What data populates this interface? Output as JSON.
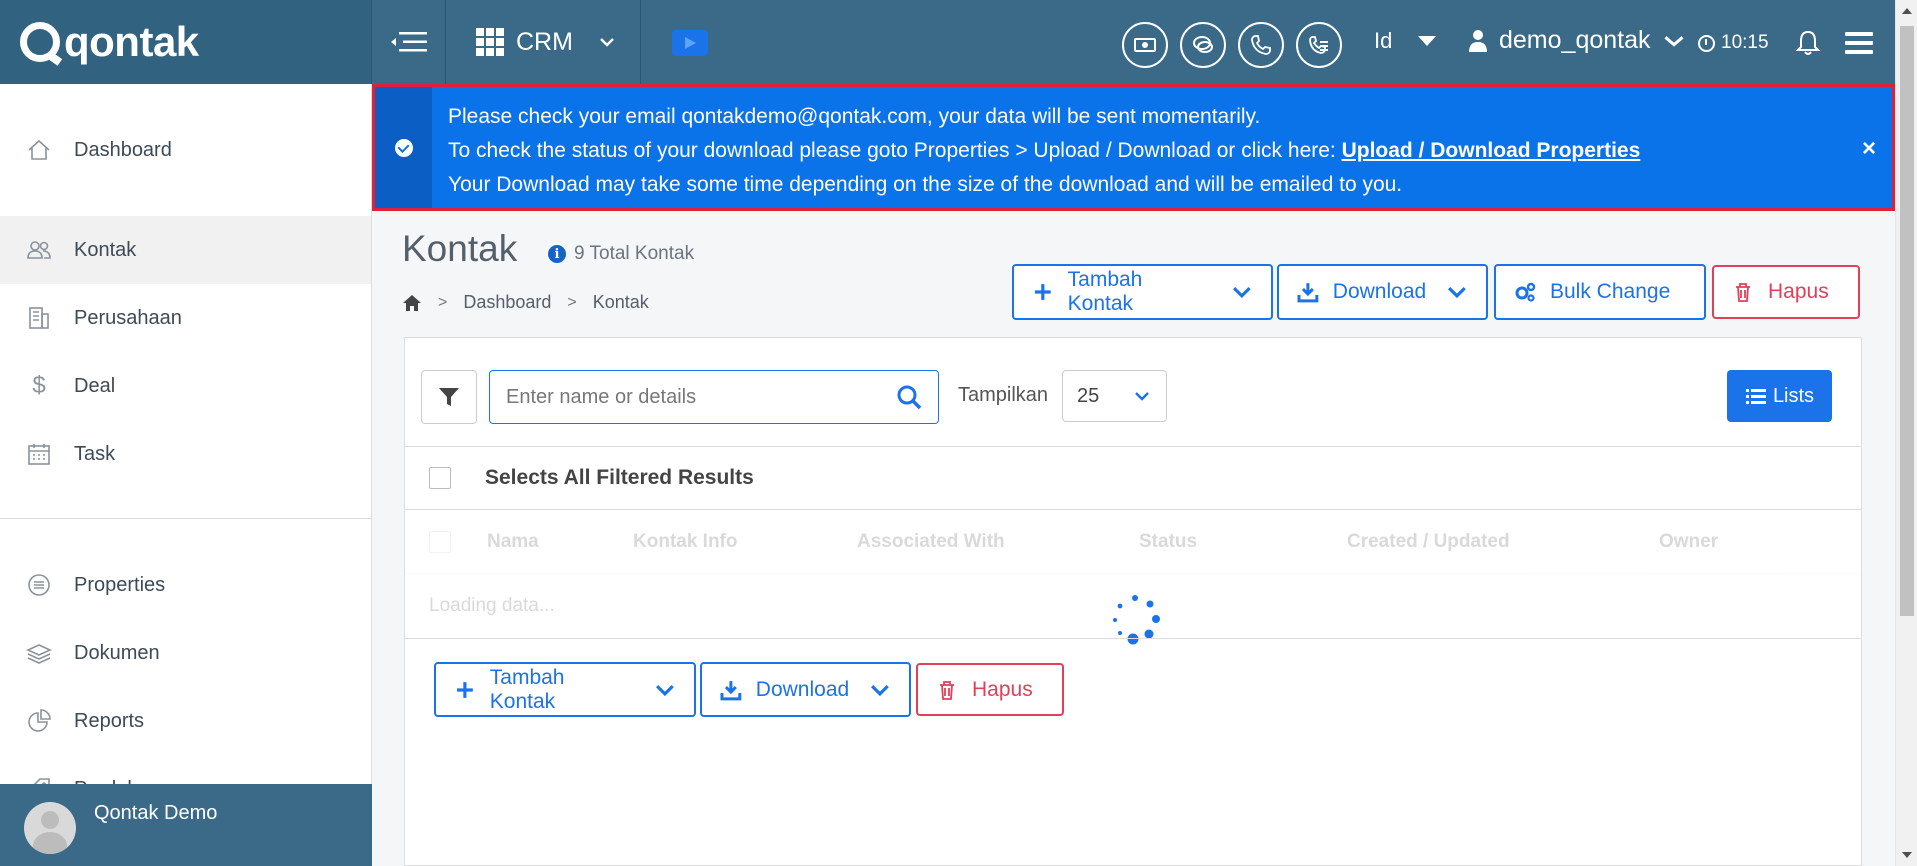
{
  "app": {
    "logo_text": "qontak",
    "module_label": "CRM",
    "lang_label": "Id",
    "username": "demo_qontak",
    "time": "10:15"
  },
  "sidebar": {
    "items": [
      {
        "label": "Dashboard",
        "icon": "home-icon"
      },
      {
        "label": "Kontak",
        "icon": "contacts-icon"
      },
      {
        "label": "Perusahaan",
        "icon": "building-icon"
      },
      {
        "label": "Deal",
        "icon": "dollar-icon"
      },
      {
        "label": "Task",
        "icon": "calendar-icon"
      },
      {
        "label": "Properties",
        "icon": "list-circle-icon"
      },
      {
        "label": "Dokumen",
        "icon": "layers-icon"
      },
      {
        "label": "Reports",
        "icon": "pie-chart-icon"
      },
      {
        "label": "Produk",
        "icon": "tag-icon"
      }
    ],
    "user_name": "Qontak Demo"
  },
  "alert": {
    "line1": "Please check your email qontakdemo@qontak.com, your data will be sent momentarily.",
    "line2_prefix": "To check the status of your download please goto Properties > Upload / Download or click here: ",
    "line2_link": "Upload / Download Properties",
    "line3": "Your Download may take some time depending on the size of the download and will be emailed to you.",
    "close_label": "×",
    "color": "#0a73ea"
  },
  "page": {
    "title": "Kontak",
    "total_label": "9 Total Kontak",
    "breadcrumb": [
      "Dashboard",
      "Kontak"
    ]
  },
  "actions": {
    "add_contact": "Tambah Kontak",
    "download": "Download",
    "bulk_change": "Bulk Change",
    "delete": "Hapus"
  },
  "toolbar": {
    "search_placeholder": "Enter name or details",
    "show_label": "Tampilkan",
    "page_size": "25",
    "lists_label": "Lists"
  },
  "table": {
    "select_all_label": "Selects All Filtered Results",
    "columns": [
      "Nama",
      "Kontak Info",
      "Associated With",
      "Status",
      "Created / Updated",
      "Owner"
    ],
    "loading_text": "Loading data..."
  },
  "colors": {
    "topbar": "#3a6a87",
    "primary": "#1a73e8",
    "danger": "#e0405a",
    "alert_border": "#e0203a"
  }
}
